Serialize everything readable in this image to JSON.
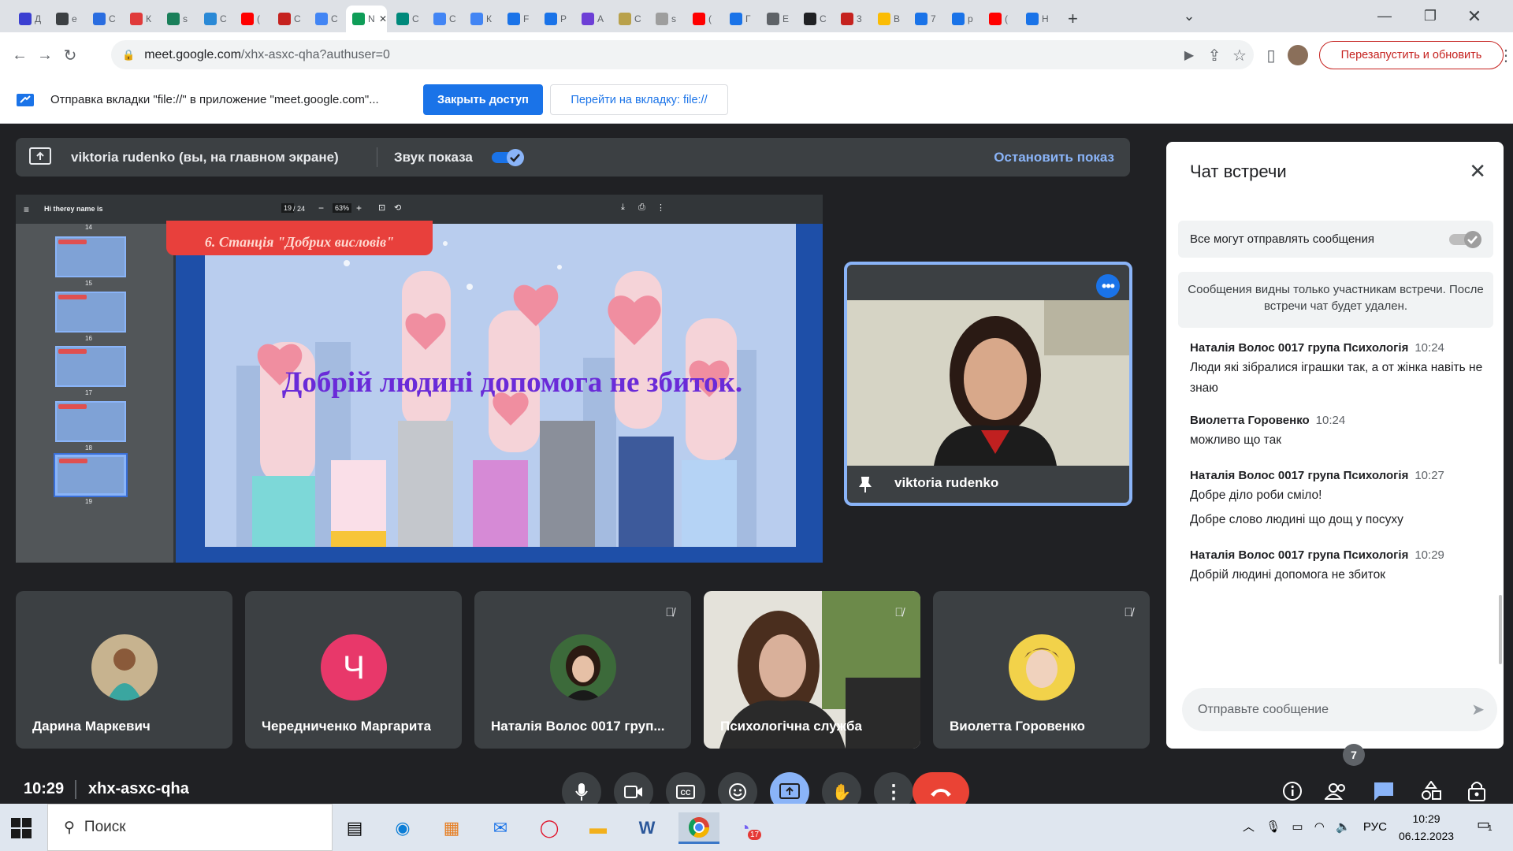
{
  "browser": {
    "tabs": [
      {
        "initial": "Д",
        "color": "#3b3fd1"
      },
      {
        "initial": "e",
        "color": "#3c4043"
      },
      {
        "initial": "С",
        "color": "#2a6de0"
      },
      {
        "initial": "К",
        "color": "#e03a3a"
      },
      {
        "initial": "s",
        "color": "#1a7f5a"
      },
      {
        "initial": "С",
        "color": "#2a89d6"
      },
      {
        "initial": "(",
        "color": "#ff0000"
      },
      {
        "initial": "С",
        "color": "#c5221f"
      },
      {
        "initial": "С",
        "color": "#4285f4"
      },
      {
        "initial": "N",
        "color": "#0f9d58",
        "active": true
      },
      {
        "initial": "С",
        "color": "#00897b"
      },
      {
        "initial": "С",
        "color": "#4285f4"
      },
      {
        "initial": "К",
        "color": "#4285f4"
      },
      {
        "initial": "F",
        "color": "#1a73e8"
      },
      {
        "initial": "P",
        "color": "#1a73e8"
      },
      {
        "initial": "А",
        "color": "#6d3fd6"
      },
      {
        "initial": "С",
        "color": "#b9a14b"
      },
      {
        "initial": "s",
        "color": "#9e9e9e"
      },
      {
        "initial": "(",
        "color": "#ff0000"
      },
      {
        "initial": "Г",
        "color": "#1a73e8"
      },
      {
        "initial": "Е",
        "color": "#5f6368"
      },
      {
        "initial": "С",
        "color": "#202124"
      },
      {
        "initial": "3",
        "color": "#c5221f"
      },
      {
        "initial": "В",
        "color": "#fbbc04"
      },
      {
        "initial": "7",
        "color": "#1a73e8"
      },
      {
        "initial": "р",
        "color": "#1a73e8"
      },
      {
        "initial": "(",
        "color": "#ff0000"
      },
      {
        "initial": "Н",
        "color": "#1a73e8"
      }
    ],
    "new_tab": "+",
    "url_host": "meet.google.com",
    "url_path": "/xhx-asxc-qha?authuser=0",
    "relaunch_label": "Перезапустить и обновить"
  },
  "infobar": {
    "text": "Отправка вкладки \"file://\" в приложение \"meet.google.com\"...",
    "close_access": "Закрыть доступ",
    "goto_tab": "Перейти на вкладку: file://"
  },
  "presentation": {
    "presenter": "viktoria rudenko (вы, на главном экране)",
    "sound_label": "Звук показа",
    "sound_on": true,
    "stop_label": "Остановить показ"
  },
  "pdf": {
    "doc_title": "Hi therey name is",
    "page_current": "19",
    "page_total": "/ 24",
    "zoom": "63%",
    "thumbs": [
      "14",
      "15",
      "16",
      "17",
      "18",
      "19"
    ],
    "station_title": "6. Станція \"Добрих висловів\"",
    "quote": "Добрій людині допомога не збиток."
  },
  "self_tile": {
    "name": "viktoria rudenko"
  },
  "participants": [
    {
      "name": "Дарина Маркевич",
      "muted": false
    },
    {
      "name": "Чередниченко Маргарита",
      "initial": "Ч",
      "muted": false
    },
    {
      "name": "Наталія Волос 0017 груп...",
      "muted": true
    },
    {
      "name": "Психологічна служба",
      "muted": true
    },
    {
      "name": "Виолетта Горовенко",
      "muted": true
    }
  ],
  "chat": {
    "title": "Чат встречи",
    "permission_label": "Все могут отправлять сообщения",
    "note": "Сообщения видны только участникам встречи. После встречи чат будет удален.",
    "messages": [
      {
        "author": "Наталія Волос 0017 група Психологія",
        "time": "10:24",
        "lines": [
          "Люди які зібралися іграшки так, а от жінка навіть не знаю"
        ]
      },
      {
        "author": "Виолетта Горовенко",
        "time": "10:24",
        "lines": [
          "можливо що так"
        ]
      },
      {
        "author": "Наталія Волос 0017 група Психологія",
        "time": "10:27",
        "lines": [
          "Добре діло роби сміло!",
          "Добре слово людині що дощ у посуху"
        ]
      },
      {
        "author": "Наталія Волос 0017 група Психологія",
        "time": "10:29",
        "lines": [
          "Добрій людині допомога не збиток"
        ]
      }
    ],
    "input_placeholder": "Отправьте сообщение"
  },
  "footer": {
    "time": "10:29",
    "meeting_code": "xhx-asxc-qha",
    "participant_count": "7"
  },
  "taskbar": {
    "search_label": "Поиск",
    "viber_badge": "17",
    "lang": "РУС",
    "time": "10:29",
    "date": "06.12.2023",
    "notifications": "1"
  },
  "colors": {
    "accent": "#8ab4f8",
    "end_call": "#ea4335",
    "chrome_blue": "#1a73e8"
  }
}
